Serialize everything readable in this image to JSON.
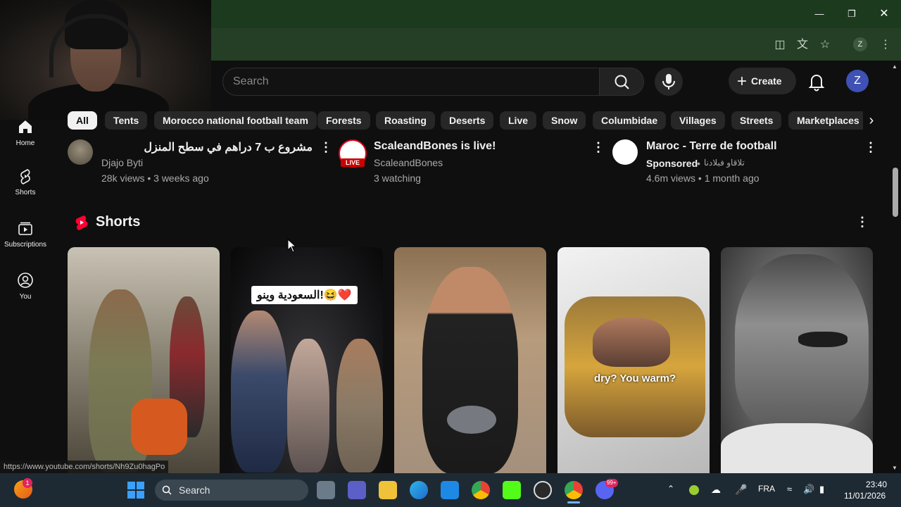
{
  "browser": {
    "profile_initial": "Z"
  },
  "masthead": {
    "search_placeholder": "Search",
    "create_label": "Create",
    "avatar_initial": "Z"
  },
  "chips": [
    {
      "label": "All",
      "active": true
    },
    {
      "label": "Tents"
    },
    {
      "label": "Morocco national football team"
    },
    {
      "label": "Forests"
    },
    {
      "label": "Roasting"
    },
    {
      "label": "Deserts"
    },
    {
      "label": "Live"
    },
    {
      "label": "Snow"
    },
    {
      "label": "Columbidae"
    },
    {
      "label": "Villages"
    },
    {
      "label": "Streets"
    },
    {
      "label": "Marketplaces"
    }
  ],
  "nav": {
    "home": "Home",
    "shorts": "Shorts",
    "subscriptions": "Subscriptions",
    "you": "You"
  },
  "videos": [
    {
      "title": "مشروع ب 7 دراهم في سطح المنزل",
      "channel": "Djajo Byti",
      "stats": "28k views • 3 weeks ago"
    },
    {
      "title": "ScaleandBones is live!",
      "channel": "ScaleandBones",
      "stats": "3 watching",
      "live_badge": "LIVE"
    },
    {
      "title": "Maroc - Terre de football",
      "sponsored": "Sponsored",
      "channel": "تلاقاو فبلادنا",
      "separator": "•",
      "stats": "4.6m views • 1 month ago"
    }
  ],
  "shorts": {
    "heading": "Shorts",
    "captions": [
      "السعودية وينو!😆❤️",
      "dry? You warm?"
    ]
  },
  "status_url": "https://www.youtube.com/shorts/Nh9Zu0hagPo",
  "taskbar": {
    "search_label": "Search",
    "language": "FRA",
    "time": "23:40",
    "date": "11/01/2026",
    "notification_count": "1",
    "discord_badge": "99+"
  },
  "colors": {
    "youtube_red": "#ff0000",
    "browser_green": "#1c3a1e",
    "background": "#0f0f0f"
  }
}
